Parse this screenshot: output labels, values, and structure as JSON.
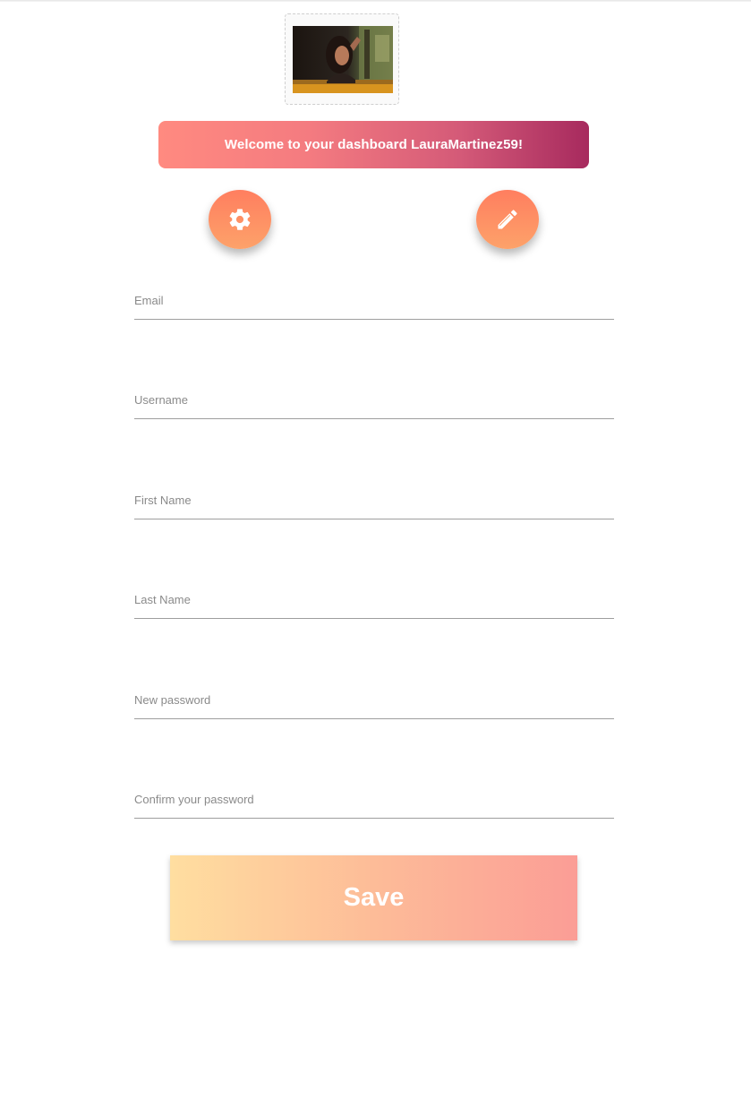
{
  "header": {
    "avatar_alt": "profile photo",
    "welcome_text": "Welcome to your dashboard LauraMartinez59!"
  },
  "actions": {
    "settings_icon": "gear-icon",
    "edit_icon": "pencil-icon"
  },
  "form": {
    "email": {
      "label": "Email",
      "value": ""
    },
    "username": {
      "label": "Username",
      "value": ""
    },
    "first_name": {
      "label": "First Name",
      "value": ""
    },
    "last_name": {
      "label": "Last Name",
      "value": ""
    },
    "new_password": {
      "label": "New password",
      "value": ""
    },
    "confirm_password": {
      "label": "Confirm your password",
      "value": ""
    }
  },
  "save_label": "Save",
  "colors": {
    "banner_start": "#ff8a80",
    "banner_end": "#a72a5e",
    "round_button_start": "#ff7e5f",
    "round_button_end": "#fda26a",
    "save_start": "#ffdea0",
    "save_end": "#fb9d96"
  }
}
